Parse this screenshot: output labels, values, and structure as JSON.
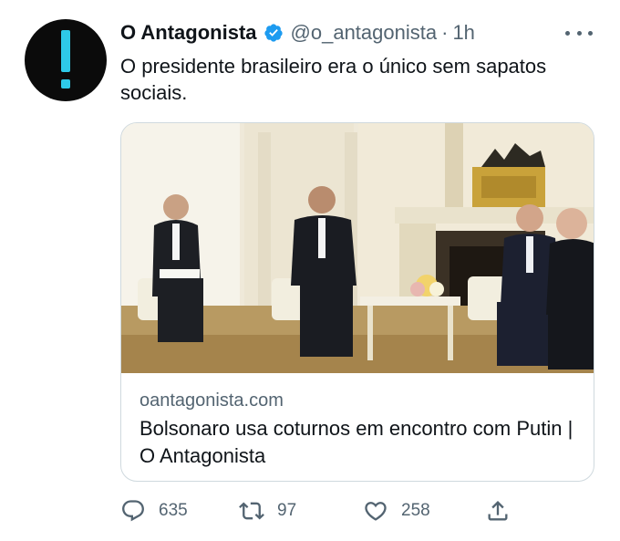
{
  "tweet": {
    "author_name": "O Antagonista",
    "handle": "@o_antagonista",
    "separator": "·",
    "time": "1h",
    "text": "O presidente brasileiro era o único sem sapatos sociais.",
    "avatar_icon": "exclamation-icon",
    "verified_icon": "verified-badge-icon",
    "more_icon": "more-options-icon"
  },
  "card": {
    "image_description_icon": "meeting-photo",
    "domain": "oantagonista.com",
    "title": "Bolsonaro usa coturnos em encontro com Putin | O Antagonista"
  },
  "actions": {
    "reply": {
      "icon": "reply-icon",
      "count": "635"
    },
    "retweet": {
      "icon": "retweet-icon",
      "count": "97"
    },
    "like": {
      "icon": "heart-icon",
      "count": "258"
    },
    "share": {
      "icon": "share-icon"
    }
  },
  "colors": {
    "text": "#0f1419",
    "secondary": "#536471",
    "verified": "#1d9bf0",
    "avatar_bg": "#0b0b0b",
    "avatar_accent": "#2ec9e8",
    "border": "#cfd9de"
  }
}
